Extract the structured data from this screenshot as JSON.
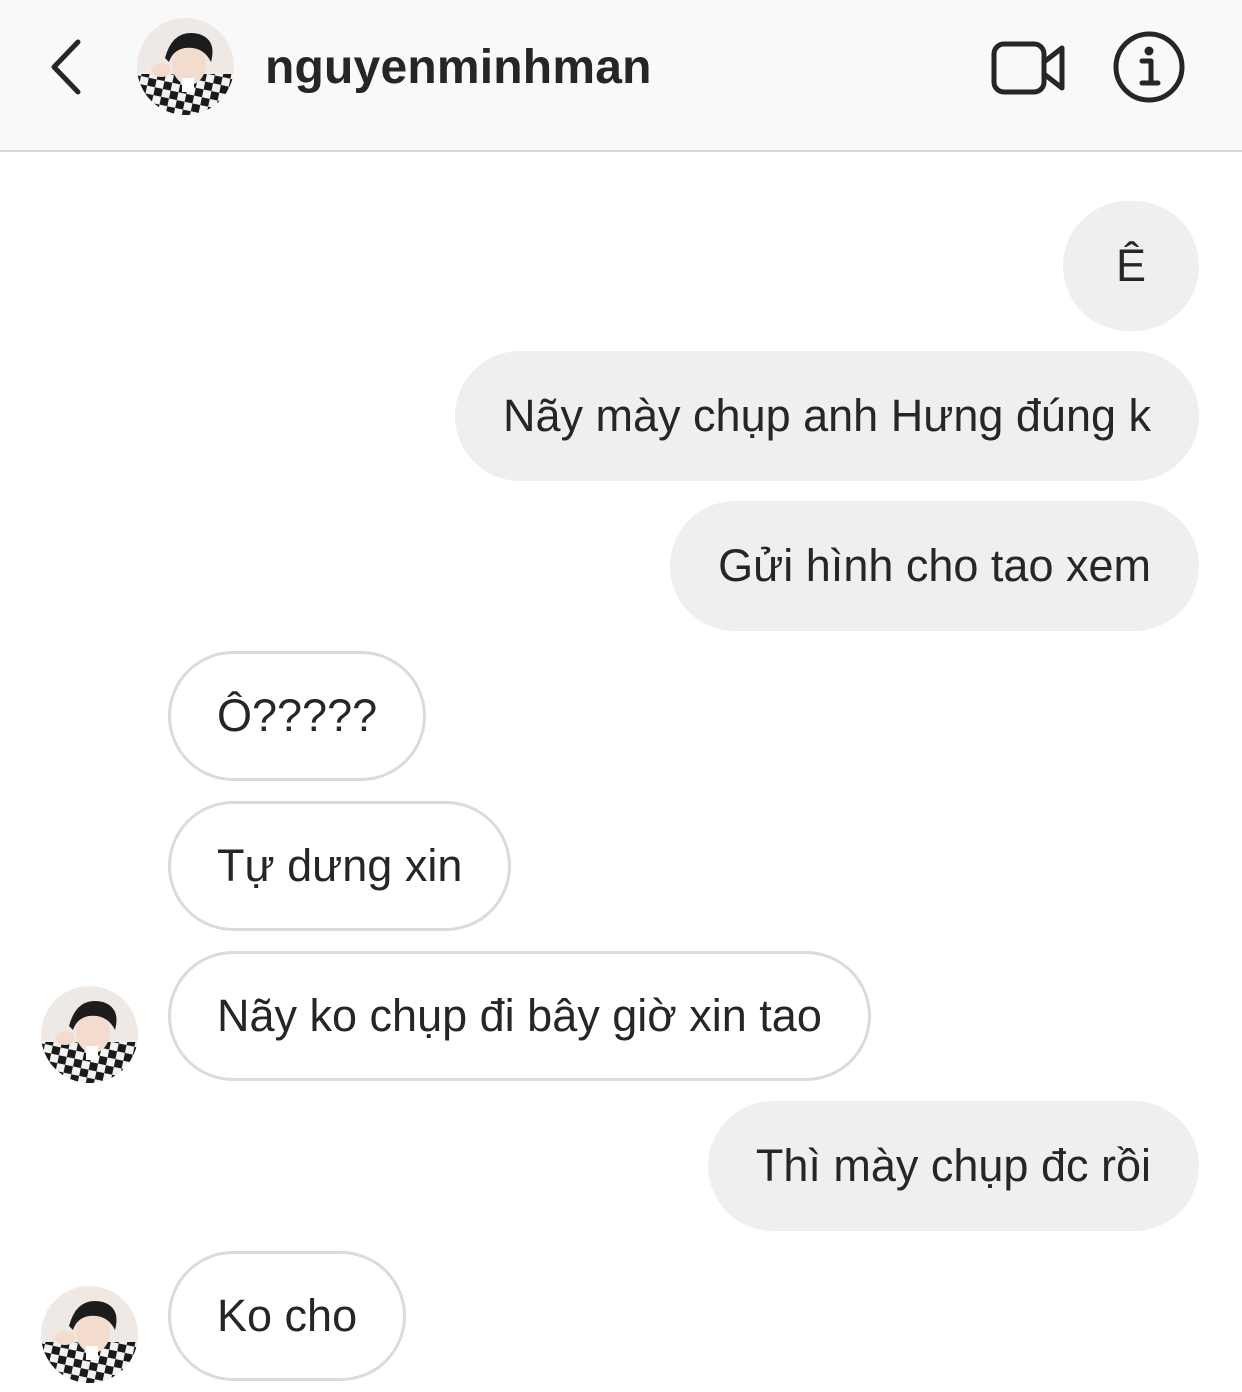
{
  "header": {
    "username": "nguyenminhman",
    "back_icon": "chevron-left-icon",
    "video_icon": "video-camera-icon",
    "info_icon": "info-icon"
  },
  "messages": [
    {
      "direction": "outgoing",
      "text": "Ê"
    },
    {
      "direction": "outgoing",
      "text": "Nãy mày chụp anh Hưng đúng k"
    },
    {
      "direction": "outgoing",
      "text": "Gửi hình cho tao xem"
    },
    {
      "direction": "incoming",
      "text": "Ô?????"
    },
    {
      "direction": "incoming",
      "text": "Tự dưng xin"
    },
    {
      "direction": "incoming",
      "text": "Nãy ko chụp đi bây giờ xin tao"
    },
    {
      "direction": "outgoing",
      "text": "Thì mày chụp đc rồi"
    },
    {
      "direction": "incoming",
      "text": "Ko cho"
    }
  ],
  "colors": {
    "header_bg": "#f9f9f9",
    "outgoing_bubble": "#efefef",
    "incoming_border": "#dbdbdb",
    "text": "#262626"
  }
}
